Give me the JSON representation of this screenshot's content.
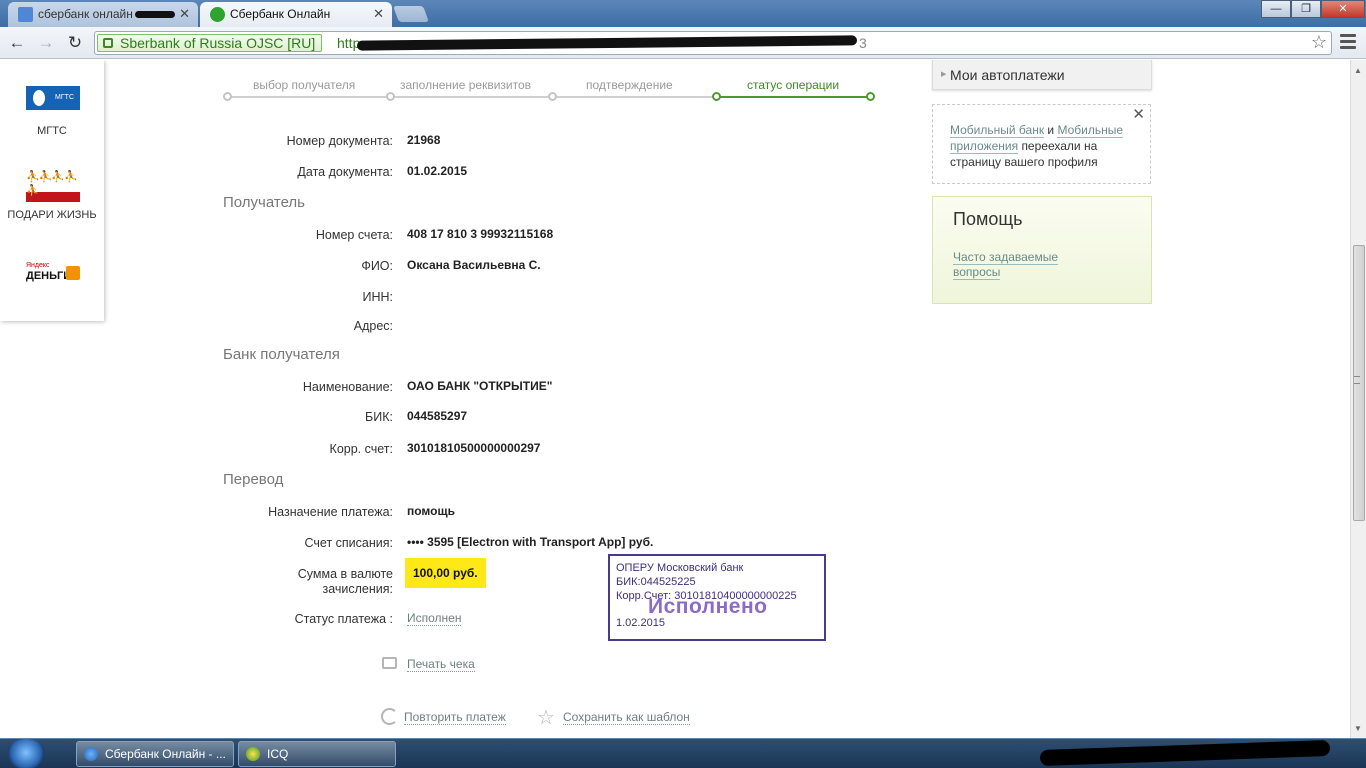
{
  "browser": {
    "tabs": [
      {
        "title": "сбербанк онлайн",
        "active": false
      },
      {
        "title": "Сбербанк Онлайн",
        "active": true
      }
    ],
    "window_controls": {
      "minimize": "—",
      "maximize": "❐",
      "close": "✕"
    },
    "ev_badge": "Sberbank of Russia OJSC [RU]",
    "url_prefix": "http",
    "url_suffix": "3"
  },
  "partners": [
    {
      "name": "МГТС",
      "logo_text": "МГТС"
    },
    {
      "name": "ПОДАРИ ЖИЗНЬ"
    },
    {
      "name": "Яндекс Деньги",
      "logo_small": "Яндекс",
      "logo_big": "ДЕНЬГИ"
    }
  ],
  "steps": [
    "выбор получателя",
    "заполнение реквизитов",
    "подтверждение",
    "статус операции"
  ],
  "doc": {
    "number_label": "Номер документа:",
    "number": "21968",
    "date_label": "Дата документа:",
    "date": "01.02.2015"
  },
  "recipient": {
    "heading": "Получатель",
    "account_label": "Номер счета:",
    "account": "408 17 810 3 99932115168",
    "fio_label": "ФИО:",
    "fio": "Оксана Васильевна С.",
    "inn_label": "ИНН:",
    "address_label": "Адрес:"
  },
  "bank": {
    "heading": "Банк получателя",
    "name_label": "Наименование:",
    "name": "ОАО БАНК \"ОТКРЫТИЕ\"",
    "bik_label": "БИК:",
    "bik": "044585297",
    "corr_label": "Корр. счет:",
    "corr": "30101810500000000297"
  },
  "transfer": {
    "heading": "Перевод",
    "purpose_label": "Назначение платежа:",
    "purpose": "помощь",
    "debit_label": "Счет списания:",
    "debit": "•••• 3595  [Electron with Transport App]  руб.",
    "amount_label": "Сумма в валюте зачисления:",
    "amount": "100,00  руб.",
    "status_label": "Статус платежа :",
    "status": "Исполнен"
  },
  "stamp": {
    "line1": "ОПЕРУ Московский банк",
    "line2": "БИК:044525225",
    "line3": "Корр.Счет: 30101810400000000225",
    "big": "Исполнено",
    "date": "1.02.2015"
  },
  "actions": {
    "print": "Печать чека",
    "repeat": "Повторить платеж",
    "save_template": "Сохранить как шаблон"
  },
  "sidebar": {
    "autopay": "Мои автоплатежи",
    "notice_link1": "Мобильный банк",
    "notice_and": "и",
    "notice_link2": "Мобильные приложения",
    "notice_rest": "переехали на страницу вашего профиля",
    "help_title": "Помощь",
    "help_link": "Часто задаваемые вопросы"
  },
  "taskbar": [
    {
      "title": "Сбербанк Онлайн - ..."
    },
    {
      "title": "ICQ"
    }
  ],
  "colors": {
    "accent_green": "#4a9a30",
    "highlight_yellow": "#ffe818",
    "stamp_violet": "#4a3b8a"
  }
}
